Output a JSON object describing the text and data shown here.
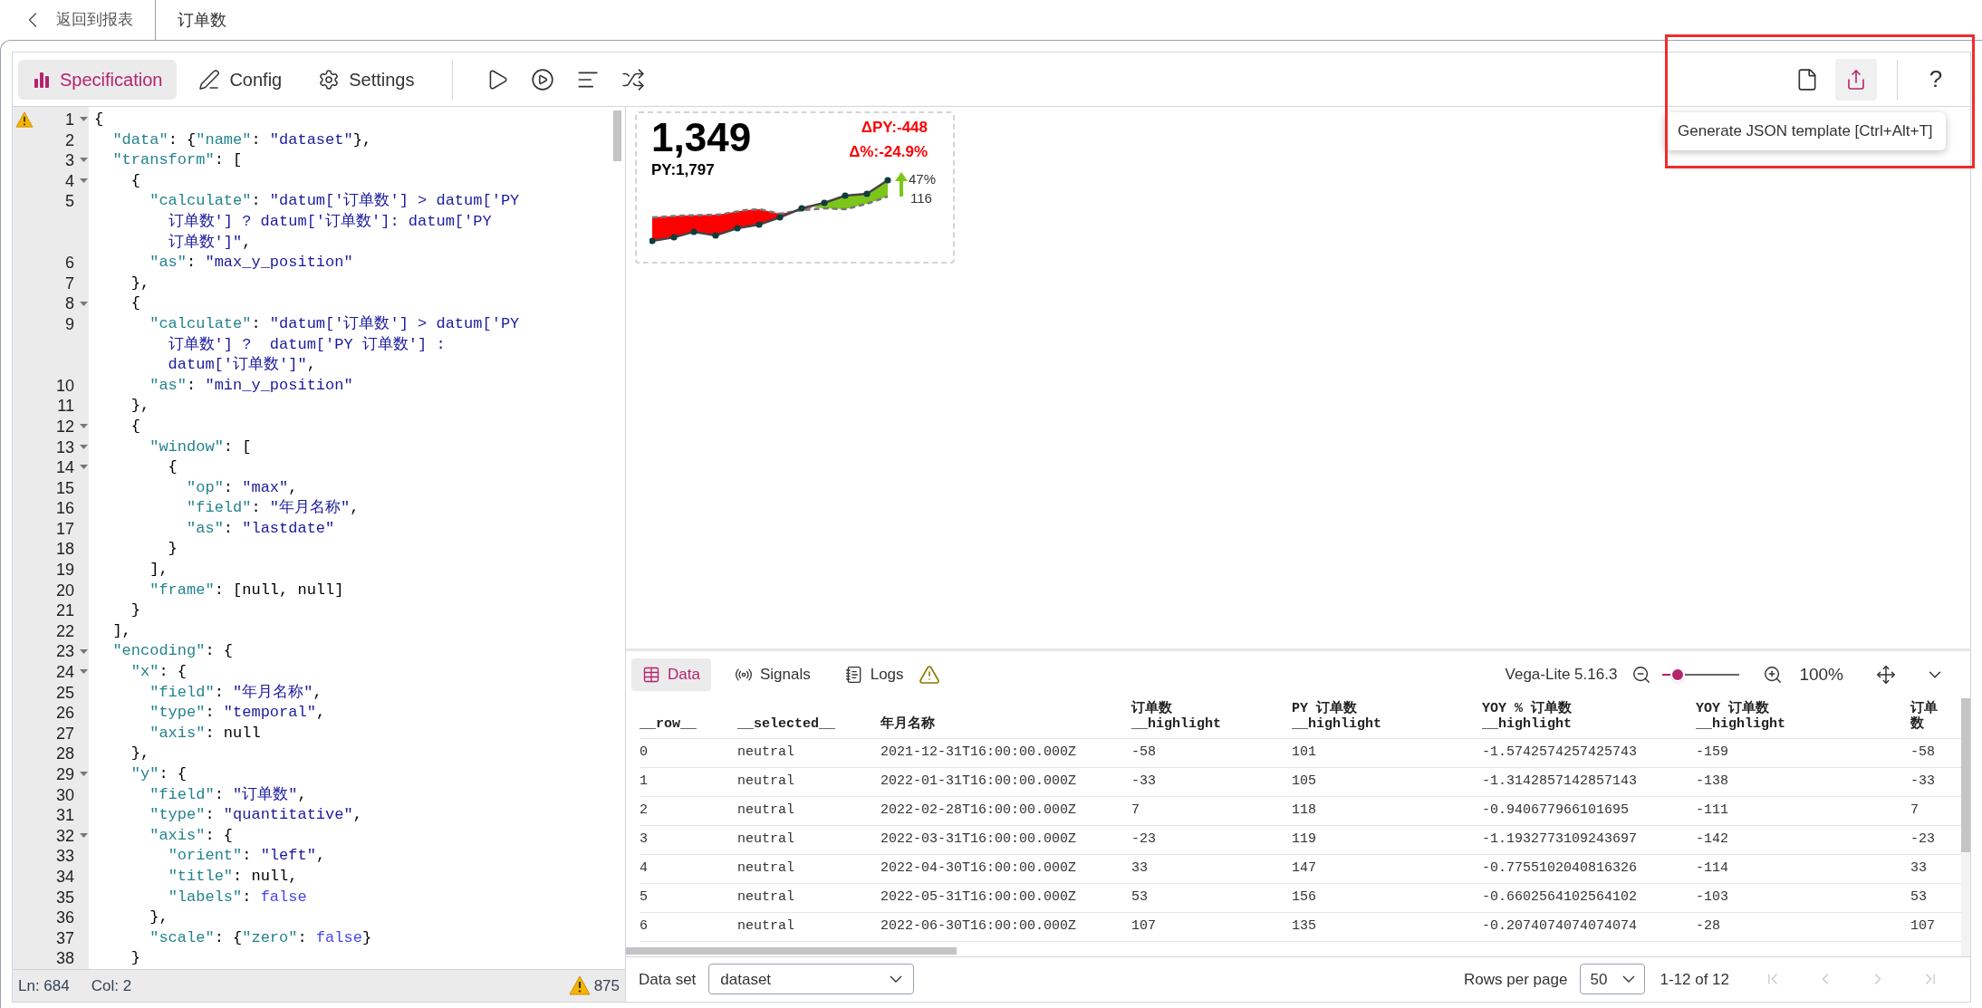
{
  "topbar": {
    "back_label": "返回到报表",
    "title": "订单数"
  },
  "toolbar": {
    "tabs": [
      {
        "label": "Specification",
        "kind": "spec",
        "selected": true
      },
      {
        "label": "Config",
        "kind": "config",
        "selected": false
      },
      {
        "label": "Settings",
        "kind": "settings",
        "selected": false
      }
    ],
    "export_highlighted": true,
    "help": "?",
    "tooltip": "Generate JSON template [Ctrl+Alt+T]"
  },
  "editor": {
    "lines": [
      {
        "number": "1",
        "fold": true,
        "warning": true,
        "rows": [
          "{"
        ]
      },
      {
        "number": "2",
        "fold": false,
        "warning": false,
        "rows": [
          "  \"data\": {\"name\": \"dataset\"},"
        ]
      },
      {
        "number": "3",
        "fold": true,
        "warning": false,
        "rows": [
          "  \"transform\": ["
        ]
      },
      {
        "number": "4",
        "fold": true,
        "warning": false,
        "rows": [
          "    {"
        ]
      },
      {
        "number": "5",
        "fold": false,
        "warning": false,
        "rows": [
          "      \"calculate\": \"datum['订单数'] > datum['PY",
          "        订单数'] ? datum['订单数']: datum['PY",
          "        订单数']\","
        ]
      },
      {
        "number": "6",
        "fold": false,
        "warning": false,
        "rows": [
          "      \"as\": \"max_y_position\""
        ]
      },
      {
        "number": "7",
        "fold": false,
        "warning": false,
        "rows": [
          "    },"
        ]
      },
      {
        "number": "8",
        "fold": true,
        "warning": false,
        "rows": [
          "    {"
        ]
      },
      {
        "number": "9",
        "fold": false,
        "warning": false,
        "rows": [
          "      \"calculate\": \"datum['订单数'] > datum['PY",
          "        订单数'] ?  datum['PY 订单数'] :",
          "        datum['订单数']\","
        ]
      },
      {
        "number": "10",
        "fold": false,
        "warning": false,
        "rows": [
          "      \"as\": \"min_y_position\""
        ]
      },
      {
        "number": "11",
        "fold": false,
        "warning": false,
        "rows": [
          "    },"
        ]
      },
      {
        "number": "12",
        "fold": true,
        "warning": false,
        "rows": [
          "    {"
        ]
      },
      {
        "number": "13",
        "fold": true,
        "warning": false,
        "rows": [
          "      \"window\": ["
        ]
      },
      {
        "number": "14",
        "fold": true,
        "warning": false,
        "rows": [
          "        {"
        ]
      },
      {
        "number": "15",
        "fold": false,
        "warning": false,
        "rows": [
          "          \"op\": \"max\","
        ]
      },
      {
        "number": "16",
        "fold": false,
        "warning": false,
        "rows": [
          "          \"field\": \"年月名称\","
        ]
      },
      {
        "number": "17",
        "fold": false,
        "warning": false,
        "rows": [
          "          \"as\": \"lastdate\""
        ]
      },
      {
        "number": "18",
        "fold": false,
        "warning": false,
        "rows": [
          "        }"
        ]
      },
      {
        "number": "19",
        "fold": false,
        "warning": false,
        "rows": [
          "      ],"
        ]
      },
      {
        "number": "20",
        "fold": false,
        "warning": false,
        "rows": [
          "      \"frame\": [null, null]"
        ]
      },
      {
        "number": "21",
        "fold": false,
        "warning": false,
        "rows": [
          "    }"
        ]
      },
      {
        "number": "22",
        "fold": false,
        "warning": false,
        "rows": [
          "  ],"
        ]
      },
      {
        "number": "23",
        "fold": true,
        "warning": false,
        "rows": [
          "  \"encoding\": {"
        ]
      },
      {
        "number": "24",
        "fold": true,
        "warning": false,
        "rows": [
          "    \"x\": {"
        ]
      },
      {
        "number": "25",
        "fold": false,
        "warning": false,
        "rows": [
          "      \"field\": \"年月名称\","
        ]
      },
      {
        "number": "26",
        "fold": false,
        "warning": false,
        "rows": [
          "      \"type\": \"temporal\","
        ]
      },
      {
        "number": "27",
        "fold": false,
        "warning": false,
        "rows": [
          "      \"axis\": null"
        ]
      },
      {
        "number": "28",
        "fold": false,
        "warning": false,
        "rows": [
          "    },"
        ]
      },
      {
        "number": "29",
        "fold": true,
        "warning": false,
        "rows": [
          "    \"y\": {"
        ]
      },
      {
        "number": "30",
        "fold": false,
        "warning": false,
        "rows": [
          "      \"field\": \"订单数\","
        ]
      },
      {
        "number": "31",
        "fold": false,
        "warning": false,
        "rows": [
          "      \"type\": \"quantitative\","
        ]
      },
      {
        "number": "32",
        "fold": true,
        "warning": false,
        "rows": [
          "      \"axis\": {"
        ]
      },
      {
        "number": "33",
        "fold": false,
        "warning": false,
        "rows": [
          "        \"orient\": \"left\","
        ]
      },
      {
        "number": "34",
        "fold": false,
        "warning": false,
        "rows": [
          "        \"title\": null,"
        ]
      },
      {
        "number": "35",
        "fold": false,
        "warning": false,
        "rows": [
          "        \"labels\": false"
        ]
      },
      {
        "number": "36",
        "fold": false,
        "warning": false,
        "rows": [
          "      },"
        ]
      },
      {
        "number": "37",
        "fold": false,
        "warning": false,
        "rows": [
          "      \"scale\": {\"zero\": false}"
        ]
      },
      {
        "number": "38",
        "fold": false,
        "warning": false,
        "rows": [
          "    }"
        ]
      }
    ],
    "status": {
      "line": "Ln: 684",
      "column": "Col: 2",
      "warnings": "875"
    }
  },
  "kpi": {
    "value": "1,349",
    "previous": "PY:1,797",
    "delta": "ΔPY:-448",
    "delta_percent": "Δ%:-24.9%",
    "change_percent": "47%",
    "change_value": "116"
  },
  "data_panel": {
    "tabs": [
      {
        "label": "Data",
        "kind": "data",
        "selected": true,
        "warning": false
      },
      {
        "label": "Signals",
        "kind": "signals",
        "selected": false,
        "warning": false
      },
      {
        "label": "Logs",
        "kind": "logs",
        "selected": false,
        "warning": true
      }
    ],
    "version": "Vega-Lite 5.16.3",
    "zoom": {
      "level": 0.2,
      "reading": "100%"
    }
  },
  "table": {
    "columns": [
      {
        "lines": [
          "__row__"
        ]
      },
      {
        "lines": [
          "__selected__"
        ]
      },
      {
        "lines": [
          "年月名称"
        ]
      },
      {
        "lines": [
          "订单数",
          "__highlight"
        ]
      },
      {
        "lines": [
          "PY 订单数",
          "__highlight"
        ]
      },
      {
        "lines": [
          "YOY % 订单数",
          "__highlight"
        ]
      },
      {
        "lines": [
          "YOY 订单数",
          "__highlight"
        ]
      },
      {
        "lines": [
          "订单数"
        ]
      }
    ],
    "rows": [
      [
        "0",
        "neutral",
        "2021-12-31T16:00:00.000Z",
        "-58",
        "101",
        "-1.5742574257425743",
        "-159",
        "-58"
      ],
      [
        "1",
        "neutral",
        "2022-01-31T16:00:00.000Z",
        "-33",
        "105",
        "-1.3142857142857143",
        "-138",
        "-33"
      ],
      [
        "2",
        "neutral",
        "2022-02-28T16:00:00.000Z",
        "7",
        "118",
        "-0.940677966101695",
        "-111",
        "7"
      ],
      [
        "3",
        "neutral",
        "2022-03-31T16:00:00.000Z",
        "-23",
        "119",
        "-1.1932773109243697",
        "-142",
        "-23"
      ],
      [
        "4",
        "neutral",
        "2022-04-30T16:00:00.000Z",
        "33",
        "147",
        "-0.7755102040816326",
        "-114",
        "33"
      ],
      [
        "5",
        "neutral",
        "2022-05-31T16:00:00.000Z",
        "53",
        "156",
        "-0.6602564102564102",
        "-103",
        "53"
      ],
      [
        "6",
        "neutral",
        "2022-06-30T16:00:00.000Z",
        "107",
        "135",
        "-0.2074074074074074",
        "-28",
        "107"
      ]
    ]
  },
  "footer": {
    "dataset_label": "Data set",
    "dataset": "dataset",
    "rows_label": "Rows per page",
    "rows_per_page": "50",
    "range": "1-12 of 12",
    "pager": [
      {
        "kind": "first",
        "disabled": true
      },
      {
        "kind": "prev",
        "disabled": true
      },
      {
        "kind": "next",
        "disabled": true
      },
      {
        "kind": "last",
        "disabled": true
      }
    ]
  }
}
